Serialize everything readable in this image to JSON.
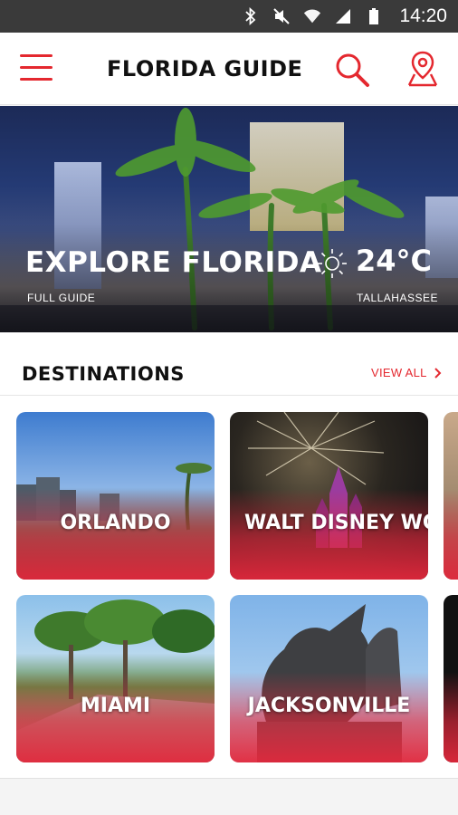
{
  "status_bar": {
    "time": "14:20",
    "icons": [
      "bluetooth-icon",
      "mute-icon",
      "wifi-icon",
      "signal-icon",
      "battery-icon"
    ]
  },
  "app_bar": {
    "title": "FLORIDA GUIDE",
    "menu_icon": "hamburger-menu-icon",
    "search_icon": "search-icon",
    "map_icon": "map-pin-icon"
  },
  "hero": {
    "title": "EXPLORE FLORIDA",
    "subtitle": "FULL GUIDE",
    "temperature": "24°C",
    "city": "TALLAHASSEE",
    "weather_icon": "sun-icon"
  },
  "destinations": {
    "heading": "DESTINATIONS",
    "view_all": "VIEW ALL",
    "cards": [
      {
        "label": "ORLANDO"
      },
      {
        "label": "WALT DISNEY WO"
      },
      {
        "label": "MIAMI"
      },
      {
        "label": "JACKSONVILLE"
      }
    ]
  },
  "colors": {
    "accent": "#e4282f",
    "status_bar": "#3a3a3a"
  }
}
